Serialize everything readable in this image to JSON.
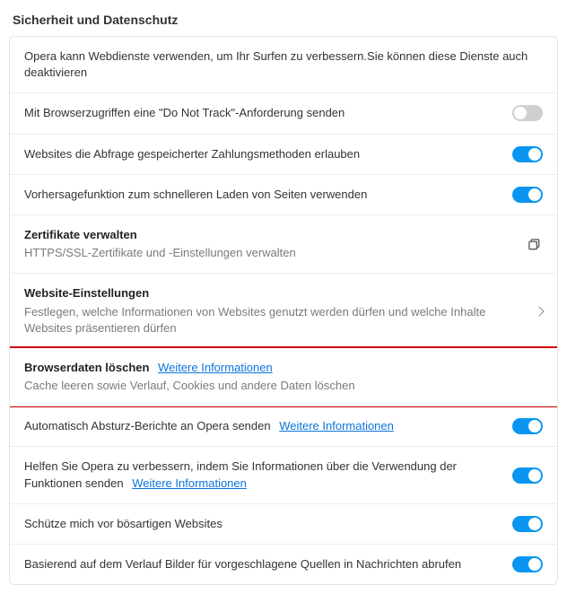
{
  "page_title": "Sicherheit und Datenschutz",
  "rows": {
    "intro": "Opera kann Webdienste verwenden, um Ihr Surfen zu verbessern.Sie können diese Dienste auch deaktivieren",
    "dnt": "Mit Browserzugriffen eine \"Do Not Track\"-Anforderung senden",
    "payment": "Websites die Abfrage gespeicherter Zahlungsmethoden erlauben",
    "predict": "Vorhersagefunktion zum schnelleren Laden von Seiten verwenden",
    "certs_title": "Zertifikate verwalten",
    "certs_sub": "HTTPS/SSL-Zertifikate und -Einstellungen verwalten",
    "site_title": "Website-Einstellungen",
    "site_sub": "Festlegen, welche Informationen von Websites genutzt werden dürfen und welche Inhalte Websites präsentieren dürfen",
    "clear_title": "Browserdaten löschen",
    "clear_link": "Weitere Informationen",
    "clear_sub": "Cache leeren sowie Verlauf, Cookies und andere Daten löschen",
    "crash": "Automatisch Absturz-Berichte an Opera senden",
    "crash_link": "Weitere Informationen",
    "improve": "Helfen Sie Opera zu verbessern, indem Sie Informationen über die Verwendung der Funktionen senden",
    "improve_link": "Weitere Informationen",
    "malware": "Schütze mich vor bösartigen Websites",
    "images": "Basierend auf dem Verlauf Bilder für vorgeschlagene Quellen in Nachrichten abrufen"
  }
}
